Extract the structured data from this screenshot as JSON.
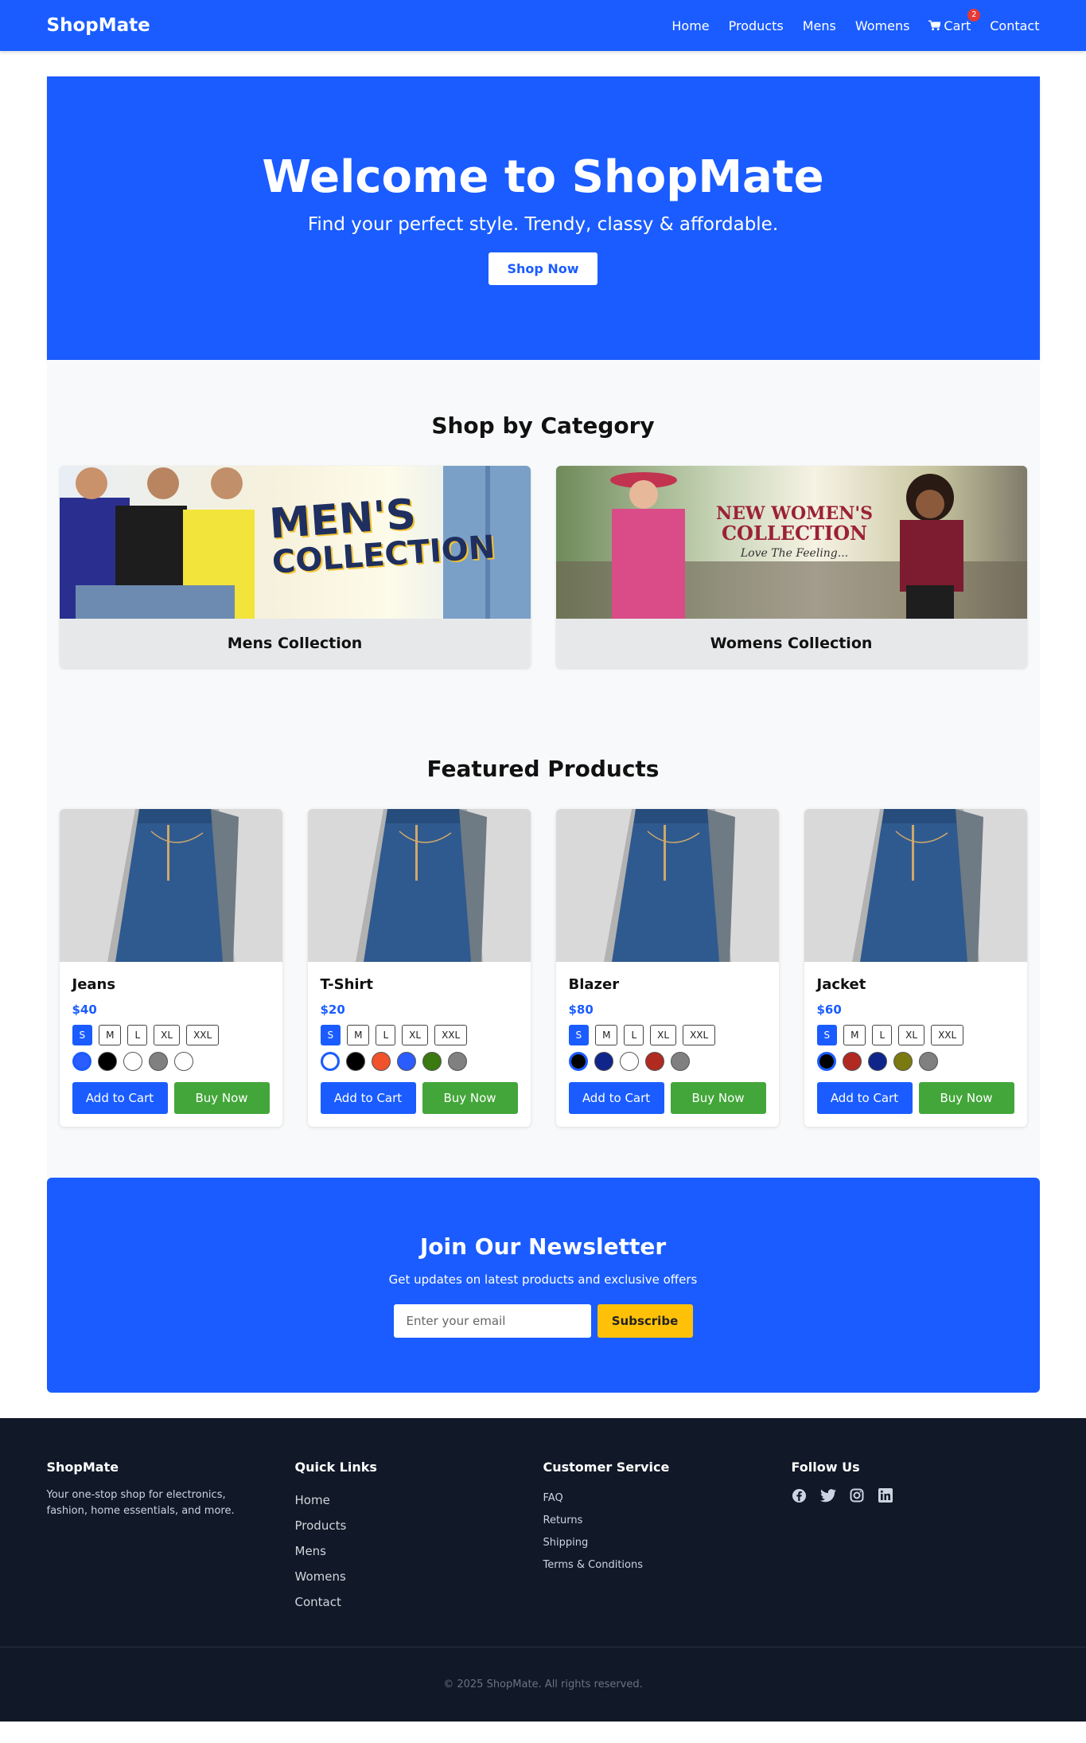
{
  "nav": {
    "brand": "ShopMate",
    "links": [
      "Home",
      "Products",
      "Mens",
      "Womens",
      "Cart",
      "Contact"
    ],
    "cart_count": "2"
  },
  "hero": {
    "title": "Welcome to ShopMate",
    "subtitle": "Find your perfect style. Trendy, classy & affordable.",
    "button": "Shop Now"
  },
  "categories": {
    "title": "Shop by Category",
    "items": [
      {
        "label": "Mens Collection",
        "banner_line1": "MEN'S",
        "banner_line2": "COLLECTION"
      },
      {
        "label": "Womens Collection",
        "banner_line1": "NEW WOMEN'S",
        "banner_line2": "COLLECTION",
        "banner_script": "Love The Feeling..."
      }
    ]
  },
  "featured": {
    "title": "Featured Products",
    "sizes": [
      "S",
      "M",
      "L",
      "XL",
      "XXL"
    ],
    "add_label": "Add to Cart",
    "buy_label": "Buy Now",
    "products": [
      {
        "name": "Jeans",
        "price": "$40",
        "colors": [
          "#2a5cff",
          "#000000",
          "#ffffff",
          "#808080",
          "#ffffff"
        ]
      },
      {
        "name": "T-Shirt",
        "price": "$20",
        "colors": [
          "#ffffff",
          "#000000",
          "#f0522b",
          "#2a5cff",
          "#3a7a10",
          "#808080"
        ]
      },
      {
        "name": "Blazer",
        "price": "$80",
        "colors": [
          "#000000",
          "#10258a",
          "#ffffff",
          "#b02a22",
          "#808080"
        ]
      },
      {
        "name": "Jacket",
        "price": "$60",
        "colors": [
          "#000000",
          "#b02a22",
          "#10258a",
          "#7a7a10",
          "#808080"
        ]
      }
    ]
  },
  "newsletter": {
    "title": "Join Our Newsletter",
    "subtitle": "Get updates on latest products and exclusive offers",
    "placeholder": "Enter your email",
    "button": "Subscribe"
  },
  "footer": {
    "brand": "ShopMate",
    "about": "Your one-stop shop for electronics, fashion, home essentials, and more.",
    "quick_title": "Quick Links",
    "quick_links": [
      "Home",
      "Products",
      "Mens",
      "Womens",
      "Contact"
    ],
    "service_title": "Customer Service",
    "service_links": [
      "FAQ",
      "Returns",
      "Shipping",
      "Terms & Conditions"
    ],
    "follow_title": "Follow Us",
    "social": [
      "facebook-icon",
      "twitter-icon",
      "instagram-icon",
      "linkedin-icon"
    ],
    "copyright": "© 2025 ShopMate. All rights reserved."
  },
  "colors": {
    "primary": "#1a5cff",
    "success": "#43a63a",
    "warning": "#ffc107",
    "footer": "#111827"
  }
}
